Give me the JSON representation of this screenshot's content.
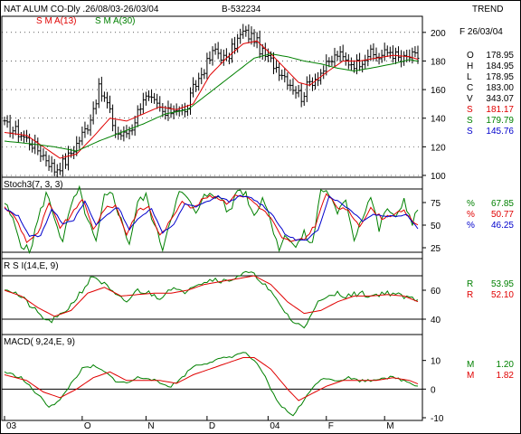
{
  "header": {
    "title": "NAT ALUM CO-Dly .26/08/03-26/03/04",
    "code": "B-532234",
    "trend": "TREND",
    "date_label": "F 26/03/04"
  },
  "colors": {
    "price": "#000000",
    "sma_short": "#e00000",
    "sma_long": "#008000",
    "k": "#008000",
    "d": "#e00000",
    "sd": "#0000cc",
    "frame": "#000000",
    "grid_dot": "#000000"
  },
  "legend": {
    "sma_short": "S M A(13)",
    "sma_long": "S M A(30)"
  },
  "stats": [
    {
      "key": "O",
      "value": "178.95",
      "color": "#000000"
    },
    {
      "key": "H",
      "value": "184.95",
      "color": "#000000"
    },
    {
      "key": "L",
      "value": "178.95",
      "color": "#000000"
    },
    {
      "key": "C",
      "value": "183.00",
      "color": "#000000"
    },
    {
      "key": "V",
      "value": "343.07",
      "color": "#000000"
    },
    {
      "key": "S",
      "value": "181.17",
      "color": "#e00000"
    },
    {
      "key": "S",
      "value": "179.79",
      "color": "#008000"
    },
    {
      "key": "S",
      "value": "145.76",
      "color": "#0000cc"
    }
  ],
  "stoch": {
    "title": "Stoch3(7, 3, 3)",
    "readings": [
      {
        "key": "%",
        "value": "67.85",
        "color": "#008000"
      },
      {
        "key": "%",
        "value": "50.77",
        "color": "#e00000"
      },
      {
        "key": "%",
        "value": "46.25",
        "color": "#0000cc"
      }
    ]
  },
  "rsi": {
    "title": "R S I(14,E, 9)",
    "readings": [
      {
        "key": "R",
        "value": "53.95",
        "color": "#008000"
      },
      {
        "key": "R",
        "value": "52.10",
        "color": "#e00000"
      }
    ]
  },
  "macd": {
    "title": "MACD( 9,24,E, 9)",
    "readings": [
      {
        "key": "M",
        "value": "1.20",
        "color": "#008000"
      },
      {
        "key": "M",
        "value": "1.82",
        "color": "#e00000"
      }
    ]
  },
  "chart_data": {
    "type": "line",
    "x_labels": [
      "03",
      "O",
      "N",
      "D",
      "04",
      "F",
      "M"
    ],
    "n": 150,
    "price": {
      "ylim": [
        100,
        210
      ],
      "ticks": [
        100,
        120,
        140,
        160,
        180,
        200
      ],
      "close_anchors": [
        [
          0,
          135
        ],
        [
          5,
          130
        ],
        [
          10,
          122
        ],
        [
          15,
          112
        ],
        [
          18,
          104
        ],
        [
          22,
          110
        ],
        [
          26,
          122
        ],
        [
          30,
          135
        ],
        [
          34,
          160
        ],
        [
          37,
          150
        ],
        [
          40,
          130
        ],
        [
          43,
          128
        ],
        [
          46,
          134
        ],
        [
          50,
          155
        ],
        [
          54,
          150
        ],
        [
          58,
          142
        ],
        [
          62,
          148
        ],
        [
          65,
          143
        ],
        [
          68,
          160
        ],
        [
          72,
          175
        ],
        [
          76,
          188
        ],
        [
          80,
          180
        ],
        [
          83,
          192
        ],
        [
          86,
          200
        ],
        [
          90,
          196
        ],
        [
          93,
          185
        ],
        [
          97,
          178
        ],
        [
          100,
          172
        ],
        [
          104,
          162
        ],
        [
          107,
          155
        ],
        [
          110,
          165
        ],
        [
          113,
          170
        ],
        [
          117,
          178
        ],
        [
          120,
          185
        ],
        [
          123,
          180
        ],
        [
          127,
          178
        ],
        [
          131,
          185
        ],
        [
          135,
          183
        ],
        [
          139,
          187
        ],
        [
          143,
          180
        ],
        [
          146,
          183
        ],
        [
          149,
          183
        ]
      ],
      "sma_short_anchors": [
        [
          0,
          130
        ],
        [
          8,
          128
        ],
        [
          14,
          120
        ],
        [
          20,
          112
        ],
        [
          26,
          115
        ],
        [
          32,
          127
        ],
        [
          38,
          140
        ],
        [
          44,
          138
        ],
        [
          50,
          143
        ],
        [
          56,
          148
        ],
        [
          62,
          146
        ],
        [
          68,
          150
        ],
        [
          74,
          170
        ],
        [
          80,
          182
        ],
        [
          86,
          192
        ],
        [
          91,
          194
        ],
        [
          96,
          185
        ],
        [
          101,
          175
        ],
        [
          106,
          165
        ],
        [
          110,
          163
        ],
        [
          116,
          172
        ],
        [
          122,
          180
        ],
        [
          128,
          180
        ],
        [
          134,
          182
        ],
        [
          140,
          184
        ],
        [
          146,
          183
        ],
        [
          149,
          181.2
        ]
      ],
      "sma_long_anchors": [
        [
          0,
          124
        ],
        [
          10,
          122
        ],
        [
          18,
          120
        ],
        [
          26,
          117
        ],
        [
          34,
          124
        ],
        [
          42,
          130
        ],
        [
          50,
          136
        ],
        [
          58,
          143
        ],
        [
          66,
          146
        ],
        [
          74,
          158
        ],
        [
          82,
          170
        ],
        [
          90,
          182
        ],
        [
          96,
          185
        ],
        [
          102,
          183
        ],
        [
          108,
          180
        ],
        [
          114,
          178
        ],
        [
          120,
          175
        ],
        [
          126,
          173
        ],
        [
          132,
          175
        ],
        [
          140,
          178
        ],
        [
          146,
          181
        ],
        [
          149,
          179.8
        ]
      ]
    },
    "stochastic": {
      "ylim": [
        15,
        100
      ],
      "ticks": [
        25,
        50,
        75
      ],
      "ref_lines": [
        20,
        90
      ],
      "k_anchors": [
        [
          0,
          75
        ],
        [
          3,
          55
        ],
        [
          6,
          30
        ],
        [
          9,
          20
        ],
        [
          12,
          55
        ],
        [
          15,
          85
        ],
        [
          18,
          60
        ],
        [
          21,
          30
        ],
        [
          24,
          72
        ],
        [
          27,
          88
        ],
        [
          30,
          55
        ],
        [
          33,
          30
        ],
        [
          36,
          80
        ],
        [
          39,
          85
        ],
        [
          42,
          55
        ],
        [
          45,
          30
        ],
        [
          48,
          75
        ],
        [
          51,
          82
        ],
        [
          54,
          50
        ],
        [
          57,
          25
        ],
        [
          60,
          60
        ],
        [
          63,
          85
        ],
        [
          66,
          80
        ],
        [
          69,
          60
        ],
        [
          72,
          88
        ],
        [
          75,
          80
        ],
        [
          78,
          82
        ],
        [
          81,
          62
        ],
        [
          84,
          90
        ],
        [
          87,
          85
        ],
        [
          90,
          60
        ],
        [
          93,
          82
        ],
        [
          96,
          55
        ],
        [
          99,
          25
        ],
        [
          102,
          40
        ],
        [
          105,
          25
        ],
        [
          108,
          40
        ],
        [
          111,
          28
        ],
        [
          114,
          90
        ],
        [
          117,
          85
        ],
        [
          120,
          60
        ],
        [
          123,
          80
        ],
        [
          126,
          35
        ],
        [
          129,
          60
        ],
        [
          132,
          82
        ],
        [
          135,
          45
        ],
        [
          138,
          70
        ],
        [
          141,
          55
        ],
        [
          144,
          80
        ],
        [
          147,
          50
        ],
        [
          149,
          68
        ]
      ],
      "d_anchors": [
        [
          0,
          70
        ],
        [
          4,
          58
        ],
        [
          8,
          32
        ],
        [
          12,
          40
        ],
        [
          16,
          74
        ],
        [
          20,
          48
        ],
        [
          24,
          60
        ],
        [
          28,
          80
        ],
        [
          32,
          45
        ],
        [
          36,
          68
        ],
        [
          40,
          72
        ],
        [
          44,
          40
        ],
        [
          48,
          66
        ],
        [
          52,
          70
        ],
        [
          56,
          38
        ],
        [
          60,
          55
        ],
        [
          64,
          78
        ],
        [
          68,
          68
        ],
        [
          72,
          80
        ],
        [
          76,
          82
        ],
        [
          80,
          75
        ],
        [
          84,
          84
        ],
        [
          88,
          80
        ],
        [
          92,
          70
        ],
        [
          96,
          58
        ],
        [
          100,
          35
        ],
        [
          104,
          32
        ],
        [
          108,
          34
        ],
        [
          112,
          50
        ],
        [
          116,
          85
        ],
        [
          120,
          70
        ],
        [
          124,
          65
        ],
        [
          128,
          50
        ],
        [
          132,
          68
        ],
        [
          136,
          58
        ],
        [
          140,
          62
        ],
        [
          144,
          65
        ],
        [
          147,
          55
        ],
        [
          149,
          50.8
        ]
      ],
      "sd_anchors": [
        [
          0,
          68
        ],
        [
          5,
          60
        ],
        [
          9,
          38
        ],
        [
          13,
          38
        ],
        [
          17,
          68
        ],
        [
          21,
          52
        ],
        [
          25,
          56
        ],
        [
          29,
          76
        ],
        [
          33,
          50
        ],
        [
          37,
          62
        ],
        [
          41,
          70
        ],
        [
          45,
          45
        ],
        [
          49,
          60
        ],
        [
          53,
          68
        ],
        [
          57,
          42
        ],
        [
          61,
          50
        ],
        [
          65,
          74
        ],
        [
          69,
          70
        ],
        [
          73,
          76
        ],
        [
          77,
          82
        ],
        [
          81,
          76
        ],
        [
          85,
          82
        ],
        [
          89,
          80
        ],
        [
          93,
          72
        ],
        [
          97,
          60
        ],
        [
          101,
          40
        ],
        [
          105,
          34
        ],
        [
          109,
          33
        ],
        [
          113,
          45
        ],
        [
          117,
          82
        ],
        [
          121,
          75
        ],
        [
          125,
          66
        ],
        [
          129,
          55
        ],
        [
          133,
          62
        ],
        [
          137,
          60
        ],
        [
          141,
          60
        ],
        [
          145,
          62
        ],
        [
          149,
          46.3
        ]
      ]
    },
    "rsi": {
      "ylim": [
        30,
        80
      ],
      "ticks": [
        40,
        60
      ],
      "ref_lines": [
        40,
        70
      ],
      "rsi_anchors": [
        [
          0,
          62
        ],
        [
          4,
          58
        ],
        [
          8,
          52
        ],
        [
          12,
          44
        ],
        [
          16,
          38
        ],
        [
          20,
          42
        ],
        [
          24,
          50
        ],
        [
          28,
          60
        ],
        [
          32,
          70
        ],
        [
          36,
          64
        ],
        [
          40,
          56
        ],
        [
          44,
          52
        ],
        [
          48,
          60
        ],
        [
          52,
          58
        ],
        [
          56,
          55
        ],
        [
          60,
          62
        ],
        [
          64,
          58
        ],
        [
          68,
          64
        ],
        [
          72,
          66
        ],
        [
          76,
          68
        ],
        [
          80,
          66
        ],
        [
          84,
          70
        ],
        [
          88,
          72
        ],
        [
          92,
          68
        ],
        [
          96,
          58
        ],
        [
          100,
          48
        ],
        [
          104,
          38
        ],
        [
          108,
          34
        ],
        [
          112,
          50
        ],
        [
          116,
          54
        ],
        [
          120,
          58
        ],
        [
          124,
          56
        ],
        [
          128,
          58
        ],
        [
          132,
          56
        ],
        [
          136,
          58
        ],
        [
          140,
          58
        ],
        [
          144,
          55
        ],
        [
          149,
          53.95
        ]
      ],
      "signal_anchors": [
        [
          0,
          60
        ],
        [
          6,
          56
        ],
        [
          12,
          48
        ],
        [
          18,
          42
        ],
        [
          24,
          46
        ],
        [
          30,
          58
        ],
        [
          36,
          62
        ],
        [
          42,
          56
        ],
        [
          48,
          57
        ],
        [
          54,
          58
        ],
        [
          60,
          58
        ],
        [
          66,
          60
        ],
        [
          72,
          64
        ],
        [
          78,
          66
        ],
        [
          84,
          68
        ],
        [
          90,
          70
        ],
        [
          96,
          64
        ],
        [
          102,
          52
        ],
        [
          108,
          44
        ],
        [
          114,
          46
        ],
        [
          120,
          52
        ],
        [
          126,
          56
        ],
        [
          132,
          56
        ],
        [
          138,
          57
        ],
        [
          144,
          56
        ],
        [
          149,
          52.1
        ]
      ]
    },
    "macd": {
      "ylim": [
        -10,
        14
      ],
      "ticks": [
        -10,
        0,
        10
      ],
      "ref_lines": [
        0
      ],
      "macd_anchors": [
        [
          0,
          6
        ],
        [
          6,
          4
        ],
        [
          12,
          -2
        ],
        [
          16,
          -6
        ],
        [
          20,
          -4
        ],
        [
          24,
          2
        ],
        [
          28,
          7
        ],
        [
          32,
          8
        ],
        [
          36,
          6
        ],
        [
          40,
          3
        ],
        [
          44,
          2
        ],
        [
          48,
          4
        ],
        [
          52,
          4
        ],
        [
          56,
          2
        ],
        [
          60,
          1
        ],
        [
          64,
          4
        ],
        [
          68,
          8
        ],
        [
          72,
          9
        ],
        [
          76,
          10
        ],
        [
          80,
          11
        ],
        [
          84,
          12
        ],
        [
          86,
          13
        ],
        [
          90,
          10
        ],
        [
          94,
          4
        ],
        [
          98,
          -4
        ],
        [
          102,
          -8
        ],
        [
          104,
          -9
        ],
        [
          108,
          -4
        ],
        [
          112,
          2
        ],
        [
          116,
          4
        ],
        [
          120,
          3
        ],
        [
          124,
          4
        ],
        [
          128,
          3
        ],
        [
          132,
          3
        ],
        [
          136,
          4
        ],
        [
          140,
          4
        ],
        [
          144,
          3
        ],
        [
          149,
          1.2
        ]
      ],
      "signal_anchors": [
        [
          0,
          5
        ],
        [
          8,
          3
        ],
        [
          14,
          -1
        ],
        [
          20,
          -3
        ],
        [
          26,
          0
        ],
        [
          32,
          4
        ],
        [
          38,
          6
        ],
        [
          44,
          3
        ],
        [
          50,
          3
        ],
        [
          56,
          3
        ],
        [
          62,
          2
        ],
        [
          68,
          5
        ],
        [
          74,
          7
        ],
        [
          80,
          9
        ],
        [
          86,
          11
        ],
        [
          90,
          11
        ],
        [
          96,
          7
        ],
        [
          102,
          0
        ],
        [
          106,
          -4
        ],
        [
          110,
          -2
        ],
        [
          116,
          1
        ],
        [
          122,
          3
        ],
        [
          128,
          3
        ],
        [
          134,
          3
        ],
        [
          140,
          4
        ],
        [
          146,
          3
        ],
        [
          149,
          1.82
        ]
      ]
    }
  }
}
